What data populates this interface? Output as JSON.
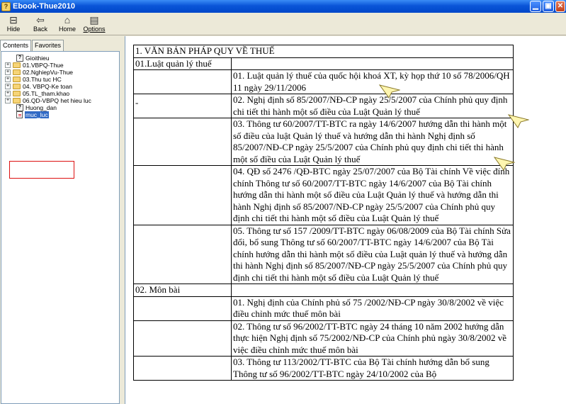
{
  "window": {
    "title": "Ebook-Thue2010"
  },
  "toolbar": {
    "hide_label": "Hide",
    "back_label": "Back",
    "home_label": "Home",
    "options_label": "Options"
  },
  "tabs": {
    "contents": "Contents",
    "favorites": "Favorites"
  },
  "tree": {
    "items": [
      {
        "label": "Gioithieu",
        "type": "topic"
      },
      {
        "label": "01.VBPQ-Thue",
        "type": "folder"
      },
      {
        "label": "02.NghiepVu-Thue",
        "type": "folder"
      },
      {
        "label": "03.Thu tuc HC",
        "type": "folder"
      },
      {
        "label": "04. VBPQ-Ke toan",
        "type": "folder"
      },
      {
        "label": "05.TL_tham.khao",
        "type": "folder"
      },
      {
        "label": "06.QD-VBPQ het hieu luc",
        "type": "folder"
      },
      {
        "label": "Huong_dan",
        "type": "topic"
      },
      {
        "label": "muc_luc",
        "type": "page",
        "selected": true
      }
    ]
  },
  "doc": {
    "header": "1. VĂN BẢN PHÁP QUY VỀ THUẾ",
    "section1": "01.Luật quản lý thuế",
    "dash": "-",
    "s1_items": [
      "01. Luật quản lý thuế của quốc hội khoá XT, kỳ họp thứ 10 số 78/2006/QH 11 ngày 29/11/2006",
      "02. Nghị định số 85/2007/NĐ-CP ngày 25/5/2007 của Chính phủ quy định chi tiết thi hành một số điều của Luật Quản lý thuế",
      "03. Thông tư 60/2007/TT-BTC ra ngày 14/6/2007 hướng dẫn thi hành một số điều của luật Quản lý thuế và hướng dẫn thi hành Nghị định số 85/2007/NĐ-CP ngày 25/5/2007 của Chính phủ quy định chi tiết thi hành một số điều của Luật Quản lý thuế",
      "04. QĐ số 2476 /QĐ-BTC ngày 25/07/2007 của Bộ Tài chính Về việc đính chính Thông tư số 60/2007/TT-BTC ngày 14/6/2007 của Bộ Tài chính hướng dẫn thi hành một số điều của Luật Quản lý thuế và hướng dẫn thi hành Nghị định số 85/2007/NĐ-CP ngày 25/5/2007 của Chính phủ quy định chi tiết thi hành một số điều của Luật Quản lý thuế",
      "05. Thông tư số 157 /2009/TT-BTC ngày 06/08/2009 của Bộ Tài chính Sửa đổi, bổ sung Thông tư số 60/2007/TT-BTC ngày 14/6/2007 của Bộ Tài chính hướng dẫn thi hành một số điều của Luật quản lý thuế và hướng dẫn thi hành Nghị định số 85/2007/NĐ-CP ngày 25/5/2007 của Chính phủ quy định chi tiết thi hành một số điều của Luật Quản lý thuế"
    ],
    "section2": "02. Môn bài",
    "s2_items": [
      "01. Nghị định của Chính phủ số 75 /2002/NĐ-CP ngày 30/8/2002 về việc điều chỉnh mức thuế môn bài",
      "02. Thông tư số 96/2002/TT-BTC ngày 24 tháng 10 năm 2002 hướng dẫn thực hiện Nghị định số 75/2002/NĐ-CP của Chính phủ ngày 30/8/2002 về việc điều chỉnh mức thuế môn bài",
      "03. Thông tư 113/2002/TT-BTC của Bộ Tài chính hướng dẫn bổ sung Thông tư số 96/2002/TT-BTC ngày 24/10/2002 của Bộ"
    ]
  }
}
